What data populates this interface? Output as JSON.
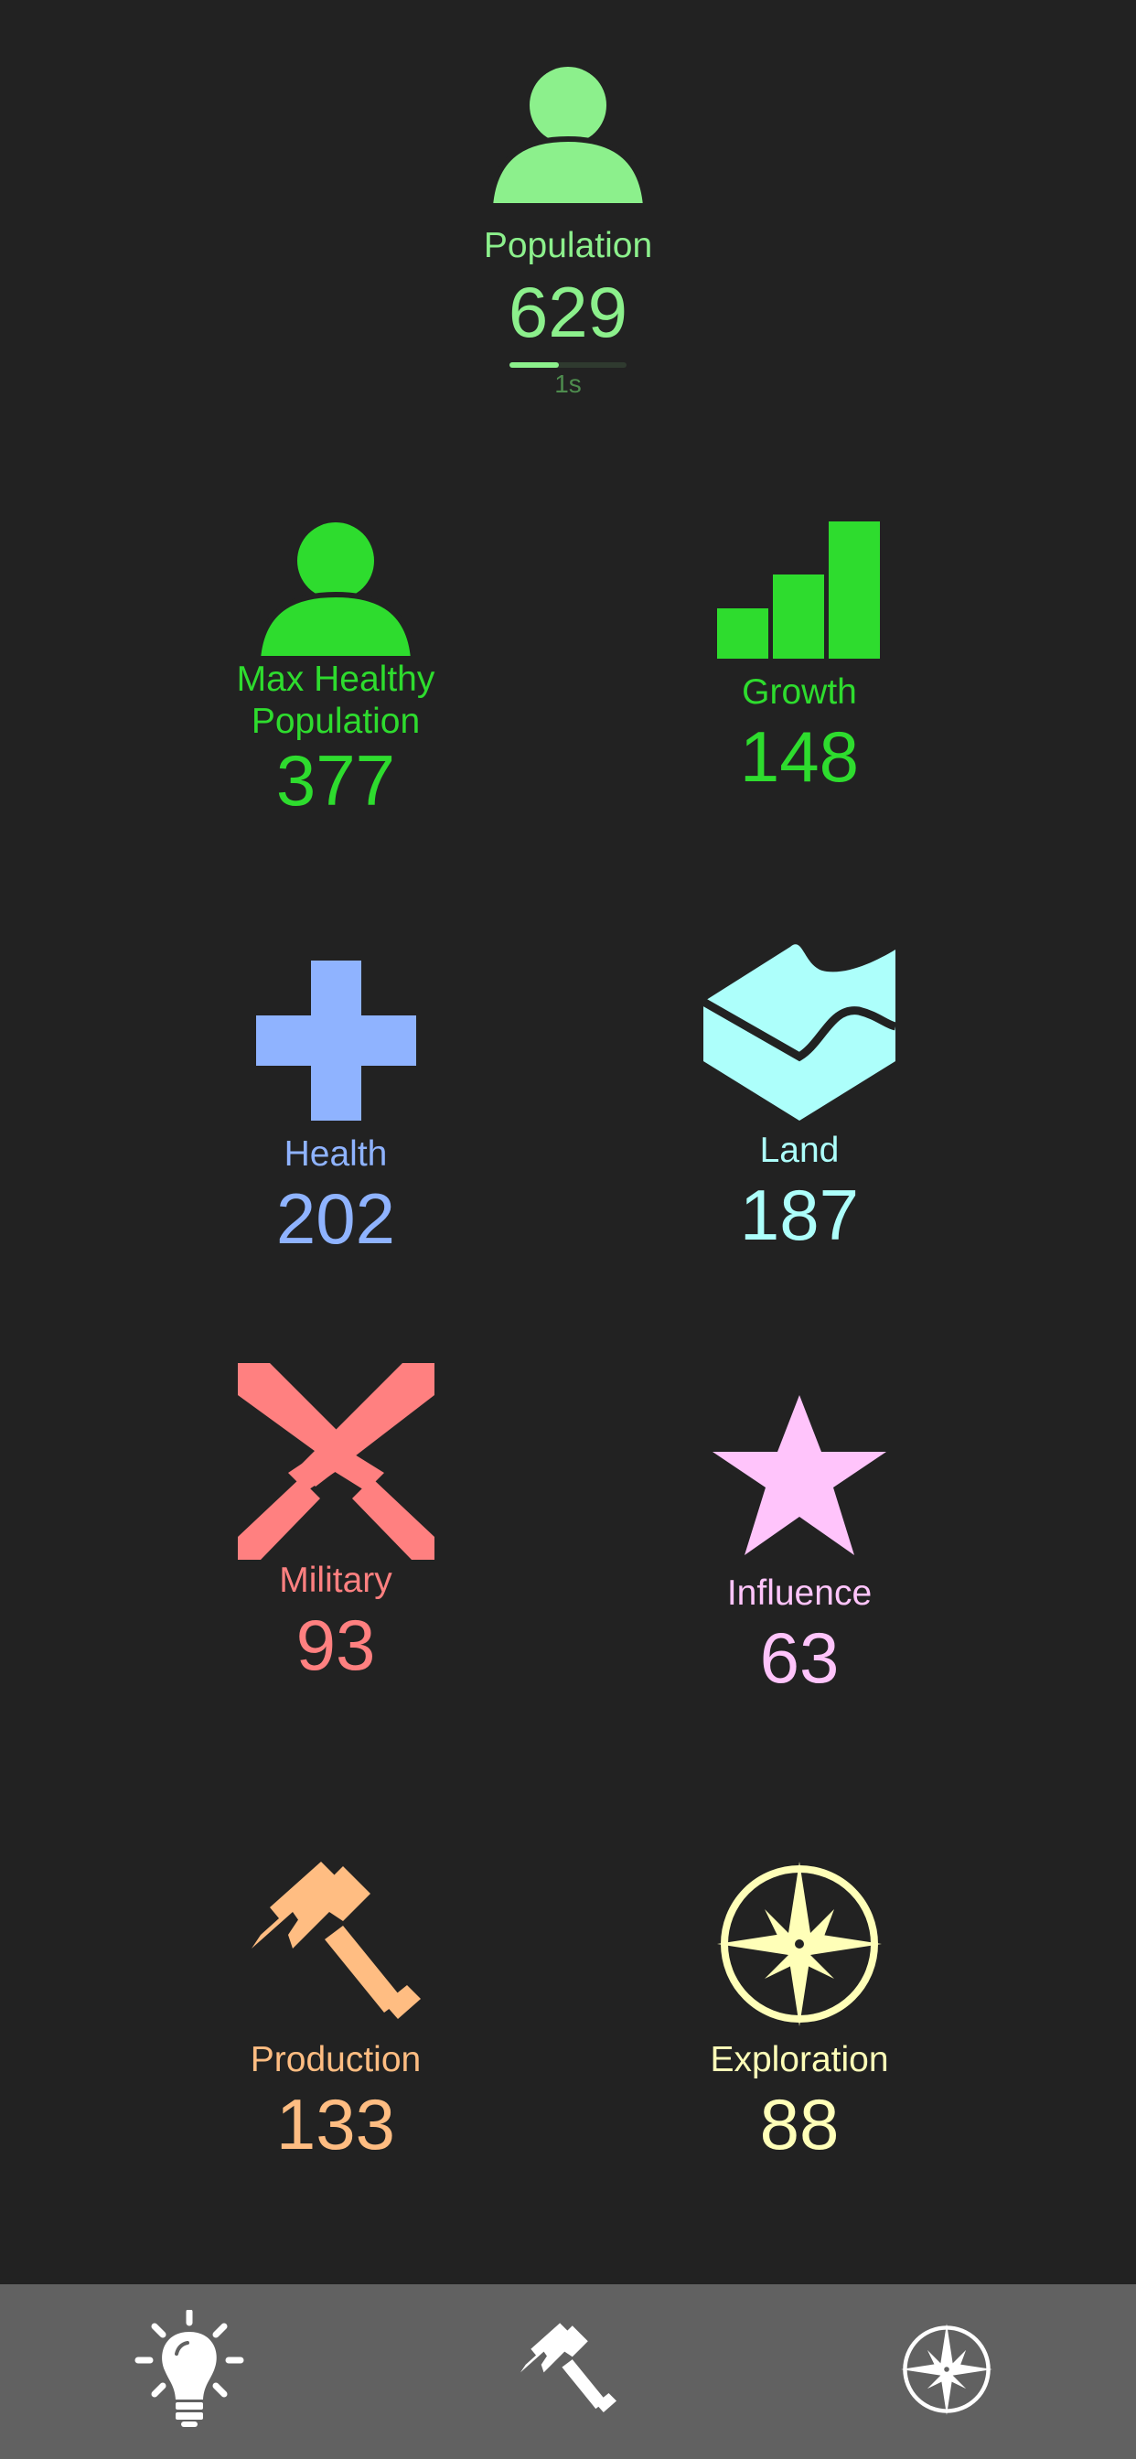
{
  "colors": {
    "background": "#222222",
    "population": "#8cf08c",
    "max_healthy": "#2edc2e",
    "growth": "#2edc2e",
    "health": "#8fb3ff",
    "land": "#adfffb",
    "military": "#ff8080",
    "influence": "#ffc4fb",
    "production": "#ffbd82",
    "exploration": "#ffffb8",
    "nav_bg": "#616161",
    "nav_icon": "#ffffff"
  },
  "population": {
    "icon": "person-icon",
    "label": "Population",
    "value": "629",
    "timer_label": "1s",
    "timer_progress": 0.42
  },
  "stats": {
    "max_healthy": {
      "icon": "person-icon",
      "label_line1": "Max Healthy",
      "label_line2": "Population",
      "value": "377"
    },
    "growth": {
      "icon": "bar-chart-icon",
      "label": "Growth",
      "value": "148"
    },
    "health": {
      "icon": "plus-cross-icon",
      "label": "Health",
      "value": "202"
    },
    "land": {
      "icon": "land-terrain-icon",
      "label": "Land",
      "value": "187"
    },
    "military": {
      "icon": "crossed-swords-icon",
      "label": "Military",
      "value": "93"
    },
    "influence": {
      "icon": "star-icon",
      "label": "Influence",
      "value": "63"
    },
    "production": {
      "icon": "gavel-icon",
      "label": "Production",
      "value": "133"
    },
    "exploration": {
      "icon": "compass-rose-icon",
      "label": "Exploration",
      "value": "88"
    }
  },
  "nav": {
    "items": [
      {
        "icon": "lightbulb-icon"
      },
      {
        "icon": "gavel-icon"
      },
      {
        "icon": "compass-rose-icon"
      }
    ]
  }
}
